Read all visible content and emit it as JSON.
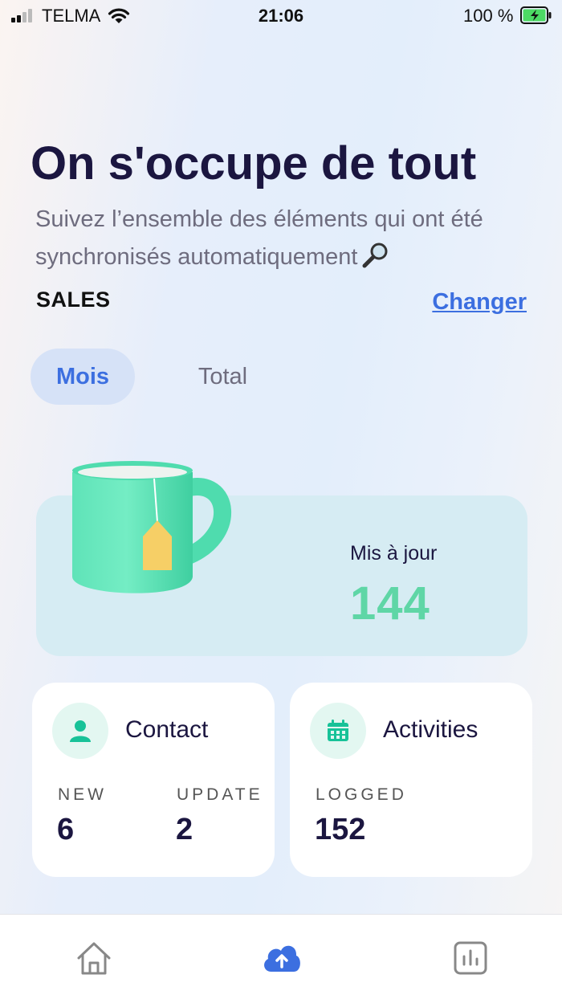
{
  "status_bar": {
    "carrier": "TELMA",
    "time": "21:06",
    "battery_percent": "100 %",
    "icons": [
      "signal-icon",
      "wifi-icon",
      "battery-charging-icon"
    ]
  },
  "header": {
    "title": "On s'occupe de tout",
    "subtitle": "Suivez l’ensemble des éléments qui ont été synchronisés automatiquement",
    "subtitle_icon": "magnifying-glass-icon",
    "org_name": "SALES",
    "change_link": "Changer"
  },
  "tabs": [
    {
      "label": "Mois",
      "active": true
    },
    {
      "label": "Total",
      "active": false
    }
  ],
  "hero": {
    "label": "Mis à jour",
    "value": "144",
    "illustration": "mug-icon"
  },
  "cards": {
    "contact": {
      "icon": "person-icon",
      "title": "Contact",
      "metrics": [
        {
          "label": "NEW",
          "value": "6"
        },
        {
          "label": "UPDATE",
          "value": "2"
        }
      ]
    },
    "activities": {
      "icon": "calendar-icon",
      "title": "Activities",
      "metrics": [
        {
          "label": "LOGGED",
          "value": "152"
        }
      ]
    }
  },
  "bottom_nav": {
    "items": [
      "home-icon",
      "cloud-upload-icon",
      "stats-icon"
    ],
    "active": "cloud-upload-icon"
  },
  "colors": {
    "title": "#1b1640",
    "accent": "#3c6fe0",
    "highlight_green": "#5fd6a6",
    "hero_card_bg": "#d6ecf3",
    "icon_green": "#17c298"
  }
}
